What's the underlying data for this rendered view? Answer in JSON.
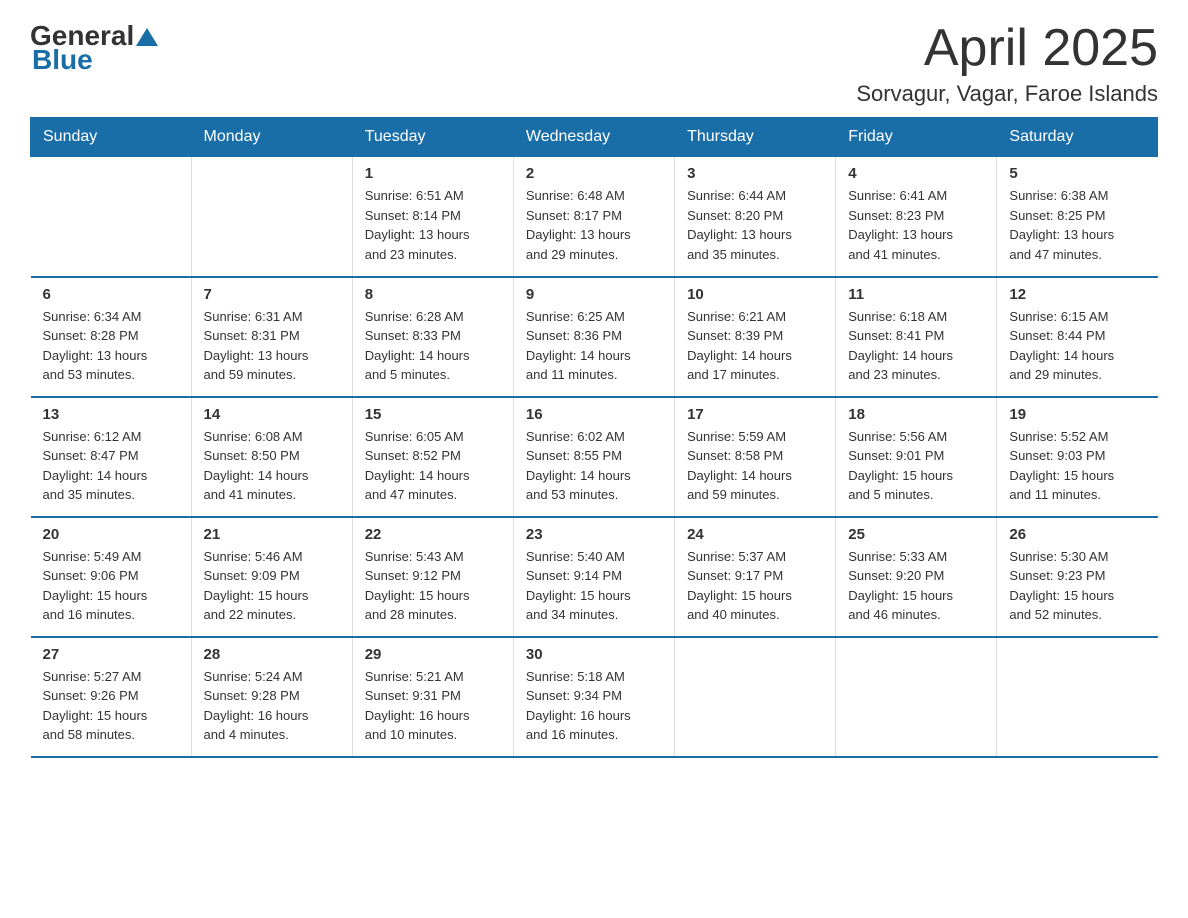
{
  "header": {
    "logo_general": "General",
    "logo_blue": "Blue",
    "month_title": "April 2025",
    "location": "Sorvagur, Vagar, Faroe Islands"
  },
  "days_of_week": [
    "Sunday",
    "Monday",
    "Tuesday",
    "Wednesday",
    "Thursday",
    "Friday",
    "Saturday"
  ],
  "weeks": [
    [
      {
        "day": "",
        "info": ""
      },
      {
        "day": "",
        "info": ""
      },
      {
        "day": "1",
        "info": "Sunrise: 6:51 AM\nSunset: 8:14 PM\nDaylight: 13 hours\nand 23 minutes."
      },
      {
        "day": "2",
        "info": "Sunrise: 6:48 AM\nSunset: 8:17 PM\nDaylight: 13 hours\nand 29 minutes."
      },
      {
        "day": "3",
        "info": "Sunrise: 6:44 AM\nSunset: 8:20 PM\nDaylight: 13 hours\nand 35 minutes."
      },
      {
        "day": "4",
        "info": "Sunrise: 6:41 AM\nSunset: 8:23 PM\nDaylight: 13 hours\nand 41 minutes."
      },
      {
        "day": "5",
        "info": "Sunrise: 6:38 AM\nSunset: 8:25 PM\nDaylight: 13 hours\nand 47 minutes."
      }
    ],
    [
      {
        "day": "6",
        "info": "Sunrise: 6:34 AM\nSunset: 8:28 PM\nDaylight: 13 hours\nand 53 minutes."
      },
      {
        "day": "7",
        "info": "Sunrise: 6:31 AM\nSunset: 8:31 PM\nDaylight: 13 hours\nand 59 minutes."
      },
      {
        "day": "8",
        "info": "Sunrise: 6:28 AM\nSunset: 8:33 PM\nDaylight: 14 hours\nand 5 minutes."
      },
      {
        "day": "9",
        "info": "Sunrise: 6:25 AM\nSunset: 8:36 PM\nDaylight: 14 hours\nand 11 minutes."
      },
      {
        "day": "10",
        "info": "Sunrise: 6:21 AM\nSunset: 8:39 PM\nDaylight: 14 hours\nand 17 minutes."
      },
      {
        "day": "11",
        "info": "Sunrise: 6:18 AM\nSunset: 8:41 PM\nDaylight: 14 hours\nand 23 minutes."
      },
      {
        "day": "12",
        "info": "Sunrise: 6:15 AM\nSunset: 8:44 PM\nDaylight: 14 hours\nand 29 minutes."
      }
    ],
    [
      {
        "day": "13",
        "info": "Sunrise: 6:12 AM\nSunset: 8:47 PM\nDaylight: 14 hours\nand 35 minutes."
      },
      {
        "day": "14",
        "info": "Sunrise: 6:08 AM\nSunset: 8:50 PM\nDaylight: 14 hours\nand 41 minutes."
      },
      {
        "day": "15",
        "info": "Sunrise: 6:05 AM\nSunset: 8:52 PM\nDaylight: 14 hours\nand 47 minutes."
      },
      {
        "day": "16",
        "info": "Sunrise: 6:02 AM\nSunset: 8:55 PM\nDaylight: 14 hours\nand 53 minutes."
      },
      {
        "day": "17",
        "info": "Sunrise: 5:59 AM\nSunset: 8:58 PM\nDaylight: 14 hours\nand 59 minutes."
      },
      {
        "day": "18",
        "info": "Sunrise: 5:56 AM\nSunset: 9:01 PM\nDaylight: 15 hours\nand 5 minutes."
      },
      {
        "day": "19",
        "info": "Sunrise: 5:52 AM\nSunset: 9:03 PM\nDaylight: 15 hours\nand 11 minutes."
      }
    ],
    [
      {
        "day": "20",
        "info": "Sunrise: 5:49 AM\nSunset: 9:06 PM\nDaylight: 15 hours\nand 16 minutes."
      },
      {
        "day": "21",
        "info": "Sunrise: 5:46 AM\nSunset: 9:09 PM\nDaylight: 15 hours\nand 22 minutes."
      },
      {
        "day": "22",
        "info": "Sunrise: 5:43 AM\nSunset: 9:12 PM\nDaylight: 15 hours\nand 28 minutes."
      },
      {
        "day": "23",
        "info": "Sunrise: 5:40 AM\nSunset: 9:14 PM\nDaylight: 15 hours\nand 34 minutes."
      },
      {
        "day": "24",
        "info": "Sunrise: 5:37 AM\nSunset: 9:17 PM\nDaylight: 15 hours\nand 40 minutes."
      },
      {
        "day": "25",
        "info": "Sunrise: 5:33 AM\nSunset: 9:20 PM\nDaylight: 15 hours\nand 46 minutes."
      },
      {
        "day": "26",
        "info": "Sunrise: 5:30 AM\nSunset: 9:23 PM\nDaylight: 15 hours\nand 52 minutes."
      }
    ],
    [
      {
        "day": "27",
        "info": "Sunrise: 5:27 AM\nSunset: 9:26 PM\nDaylight: 15 hours\nand 58 minutes."
      },
      {
        "day": "28",
        "info": "Sunrise: 5:24 AM\nSunset: 9:28 PM\nDaylight: 16 hours\nand 4 minutes."
      },
      {
        "day": "29",
        "info": "Sunrise: 5:21 AM\nSunset: 9:31 PM\nDaylight: 16 hours\nand 10 minutes."
      },
      {
        "day": "30",
        "info": "Sunrise: 5:18 AM\nSunset: 9:34 PM\nDaylight: 16 hours\nand 16 minutes."
      },
      {
        "day": "",
        "info": ""
      },
      {
        "day": "",
        "info": ""
      },
      {
        "day": "",
        "info": ""
      }
    ]
  ]
}
